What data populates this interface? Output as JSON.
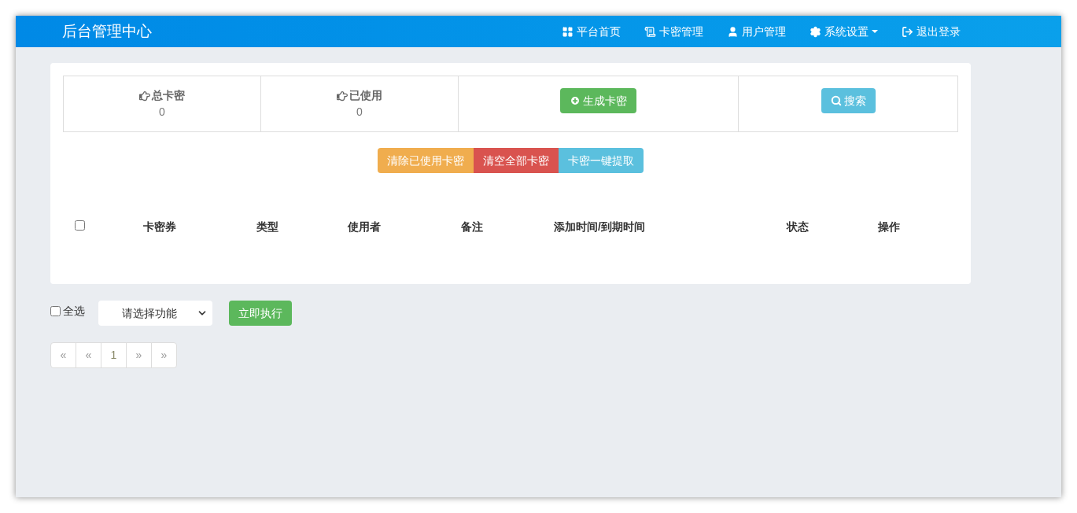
{
  "header": {
    "title": "后台管理中心",
    "nav": [
      {
        "label": "平台首页",
        "kind": "grid",
        "dropdown": false
      },
      {
        "label": "卡密管理",
        "kind": "list",
        "dropdown": false
      },
      {
        "label": "用户管理",
        "kind": "user",
        "dropdown": false
      },
      {
        "label": "系统设置",
        "kind": "gear",
        "dropdown": true
      },
      {
        "label": "退出登录",
        "kind": "logout",
        "dropdown": false
      }
    ]
  },
  "stats": [
    {
      "label": "总卡密",
      "value": "0"
    },
    {
      "label": "已使用",
      "value": "0"
    }
  ],
  "stat_buttons": [
    {
      "label": "生成卡密",
      "kind": "generate"
    },
    {
      "label": "搜索",
      "kind": "search"
    }
  ],
  "actions": [
    {
      "label": "清除已使用卡密",
      "kind": "warning"
    },
    {
      "label": "清空全部卡密",
      "kind": "danger"
    },
    {
      "label": "卡密一键提取",
      "kind": "info"
    }
  ],
  "table": {
    "select_all_checked": false,
    "columns": [
      "卡密券",
      "类型",
      "使用者",
      "备注",
      "添加时间/到期时间",
      "状态",
      "操作"
    ]
  },
  "bulk": {
    "select_all": {
      "label": "全选",
      "checked": false
    },
    "select": {
      "value": "请选择功能"
    },
    "button": "立即执行"
  },
  "pagination": [
    "«",
    "«",
    "1",
    "»",
    "»"
  ]
}
